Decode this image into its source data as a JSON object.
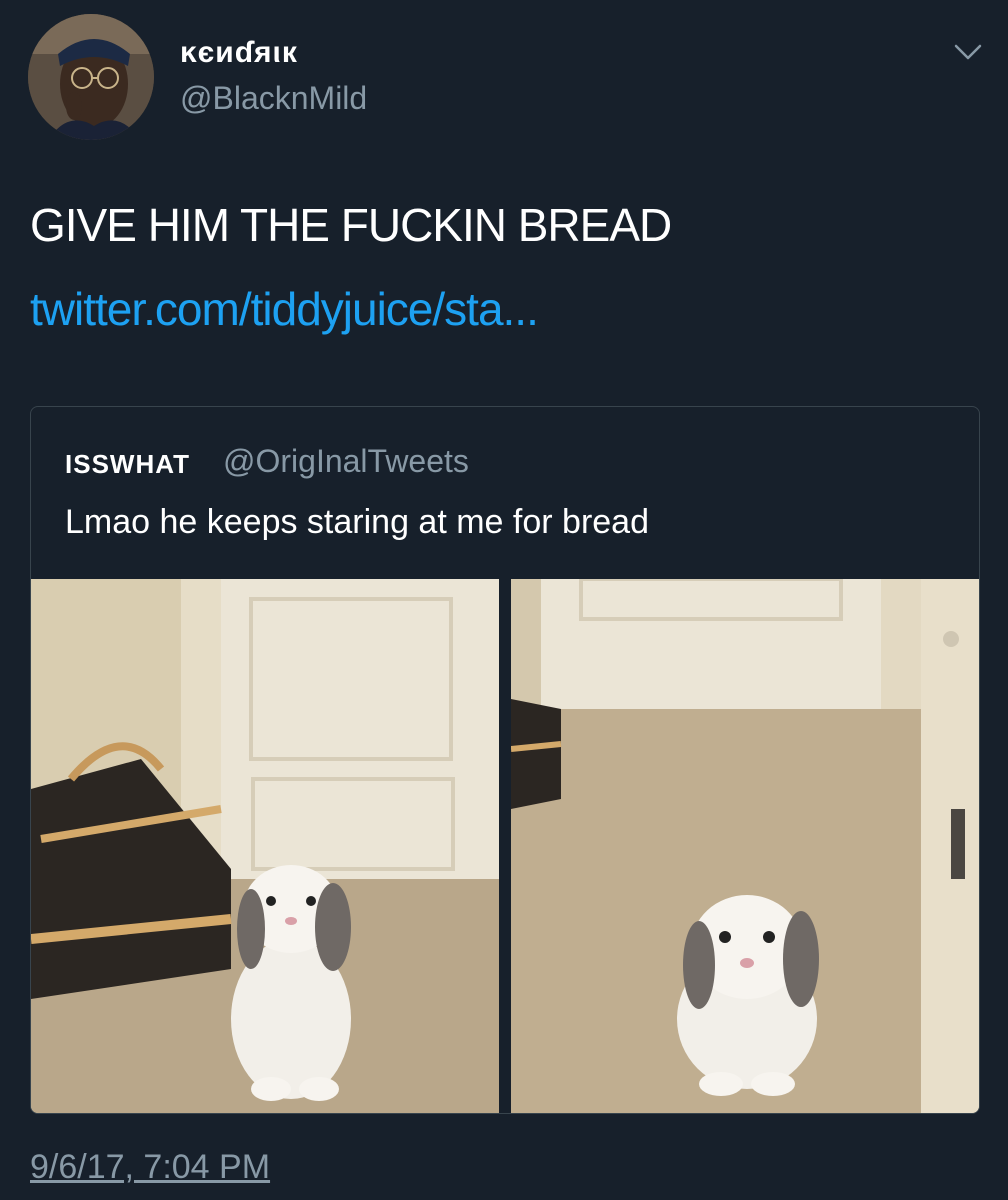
{
  "tweet": {
    "author": {
      "display_name": "ĸєиɗяιк",
      "handle": "@BlacknMild"
    },
    "text": "GIVE HIM THE FUCKIN BREAD",
    "link": "twitter.com/tiddyjuice/sta...",
    "timestamp": "9/6/17, 7:04 PM",
    "menu_icon": "chevron-down-icon"
  },
  "quote": {
    "display_name": "ISSWHAT",
    "handle": "@OrigInalTweets",
    "text": "Lmao he keeps staring at me for bread",
    "photos": [
      {
        "subject": "rabbit-photo"
      },
      {
        "subject": "rabbit-photo"
      }
    ]
  },
  "colors": {
    "background": "#17202b",
    "text": "#ffffff",
    "secondary": "#8899a6",
    "link": "#1da1f2",
    "border": "#38444d"
  }
}
